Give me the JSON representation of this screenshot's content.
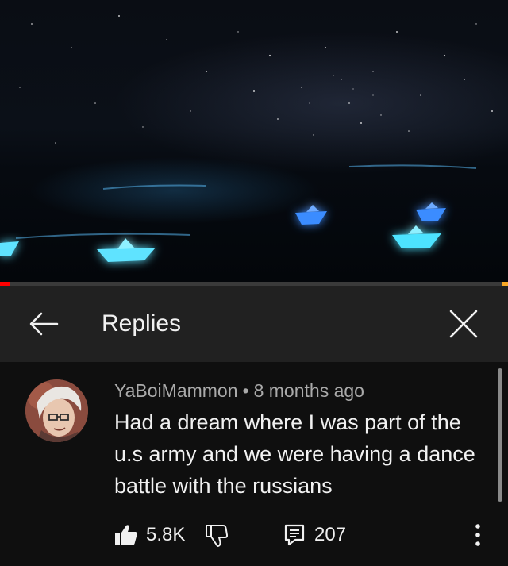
{
  "video": {
    "progress_fraction": 0.02,
    "icon": "video-frame"
  },
  "header": {
    "title": "Replies",
    "back_icon": "back-arrow-icon",
    "close_icon": "close-icon"
  },
  "comment": {
    "author": "YaBoiMammon",
    "separator": "•",
    "time": "8 months ago",
    "text": "Had a dream where I was part of the u.s army and we were having a dance battle with the russians",
    "likes": "5.8K",
    "replies": "207"
  },
  "colors": {
    "background": "#0f0f0f",
    "header": "#212121",
    "progress": "#ff0000",
    "secondary_text": "#aaaaaa"
  }
}
